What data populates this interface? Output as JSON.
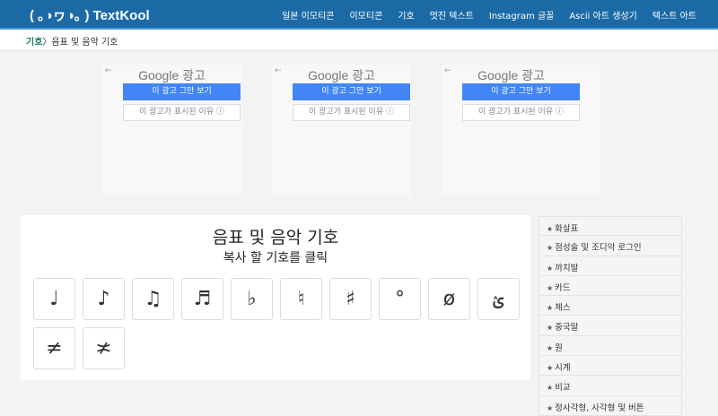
{
  "header": {
    "logo": "( ｡◑ヮ◑｡ ) TextKool",
    "nav": [
      "일본 이모티콘",
      "이모티콘",
      "기호",
      "멋진 텍스트",
      "Instagram 글꼴",
      "Ascii 아트 생성기",
      "텍스트 아트"
    ]
  },
  "breadcrumb": {
    "parent": "기호",
    "sep": "〉",
    "current": "음표 및 음악 기호"
  },
  "ads": [
    {
      "back": "←",
      "brand": "Google 광고",
      "stop": "이 광고 그만 보기",
      "why": "이 광고가 표시된 이유 ⓘ"
    },
    {
      "back": "←",
      "brand": "Google 광고",
      "stop": "이 광고 그만 보기",
      "why": "이 광고가 표시된 이유 ⓘ"
    },
    {
      "back": "←",
      "brand": "Google 광고",
      "stop": "이 광고 그만 보기",
      "why": "이 광고가 표시된 이유 ⓘ"
    }
  ],
  "main": {
    "title": "음표 및 음악 기호",
    "subtitle": "복사 할 기호를 클릭",
    "symbols": [
      "♩",
      "♪",
      "♫",
      "♬",
      "♭",
      "♮",
      "♯",
      "°",
      "ø",
      "ؽ",
      "≠",
      "≭"
    ]
  },
  "sidebar": {
    "star": "★",
    "items": [
      "화살표",
      "점성술 및 조디악 로그인",
      "까치발",
      "카드",
      "체스",
      "중국말",
      "원",
      "시계",
      "비교",
      "정사각형, 사각형 및 버튼"
    ]
  }
}
